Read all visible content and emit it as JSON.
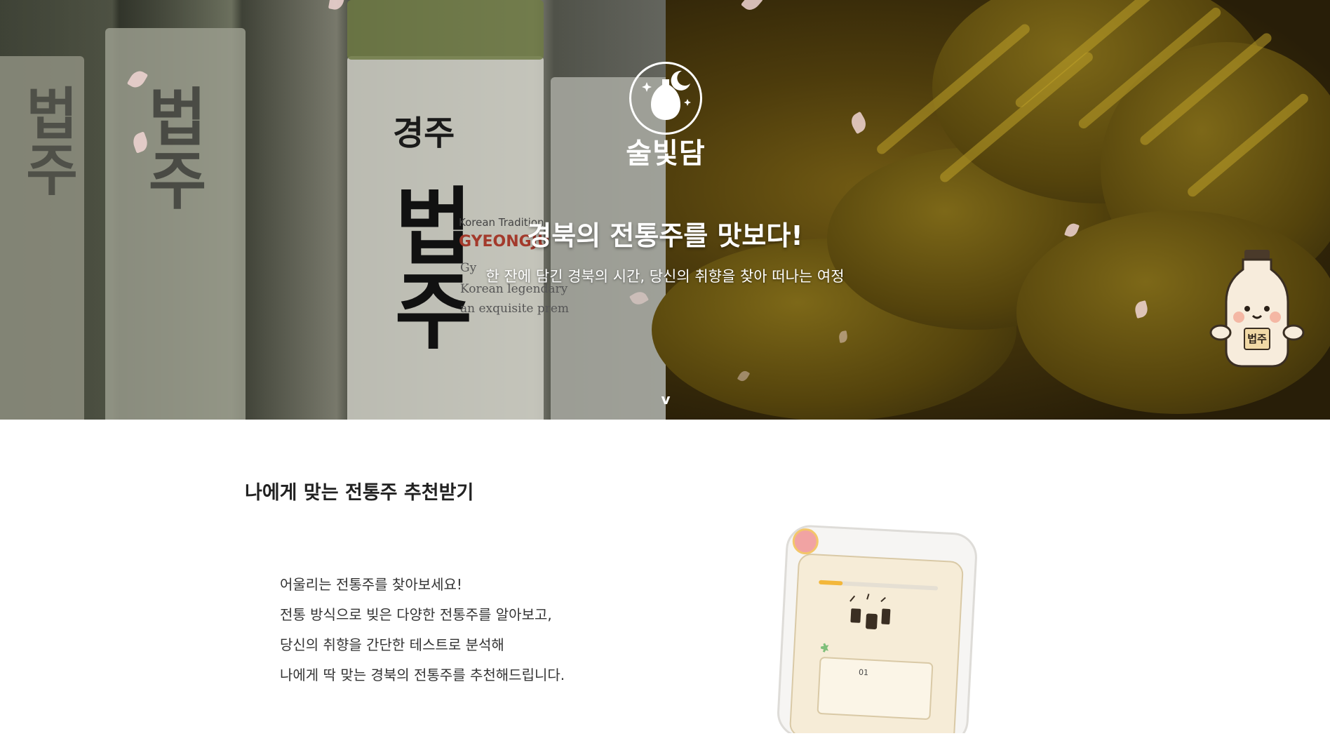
{
  "hero": {
    "logo_text": "술빛담",
    "title": "경북의 전통주를 맛보다!",
    "subtitle": "한 잔에 담긴 경북의 시간, 당신의 취향을 찾아 떠나는 여정",
    "scroll_chevron": "v",
    "mascot_label": "법주",
    "bottle_label": {
      "hangul_top": "경주",
      "hangul_main": "법주",
      "brand_small": "Korean Tradition",
      "brand": "GYEONGJU",
      "line1": "Gy",
      "line2": "Korean legendary",
      "line3": "an exquisite prem"
    }
  },
  "recommend": {
    "title": "나에게 맞는 전통주 추천받기",
    "description": [
      "어울리는 전통주를 찾아보세요!",
      "전통 방식으로 빚은 다양한 전통주를 알아보고,",
      "당신의 취향을 간단한 테스트로 분석해",
      "나에게 딱 맞는 경북의 전통주를 추천해드립니다."
    ],
    "phone_preview": {
      "question_number": "01",
      "progress": 0.2
    }
  },
  "colors": {
    "petal": "#f1d6d4",
    "progress_fill": "#f3b73a",
    "phone_screen": "#f6ecd7"
  }
}
